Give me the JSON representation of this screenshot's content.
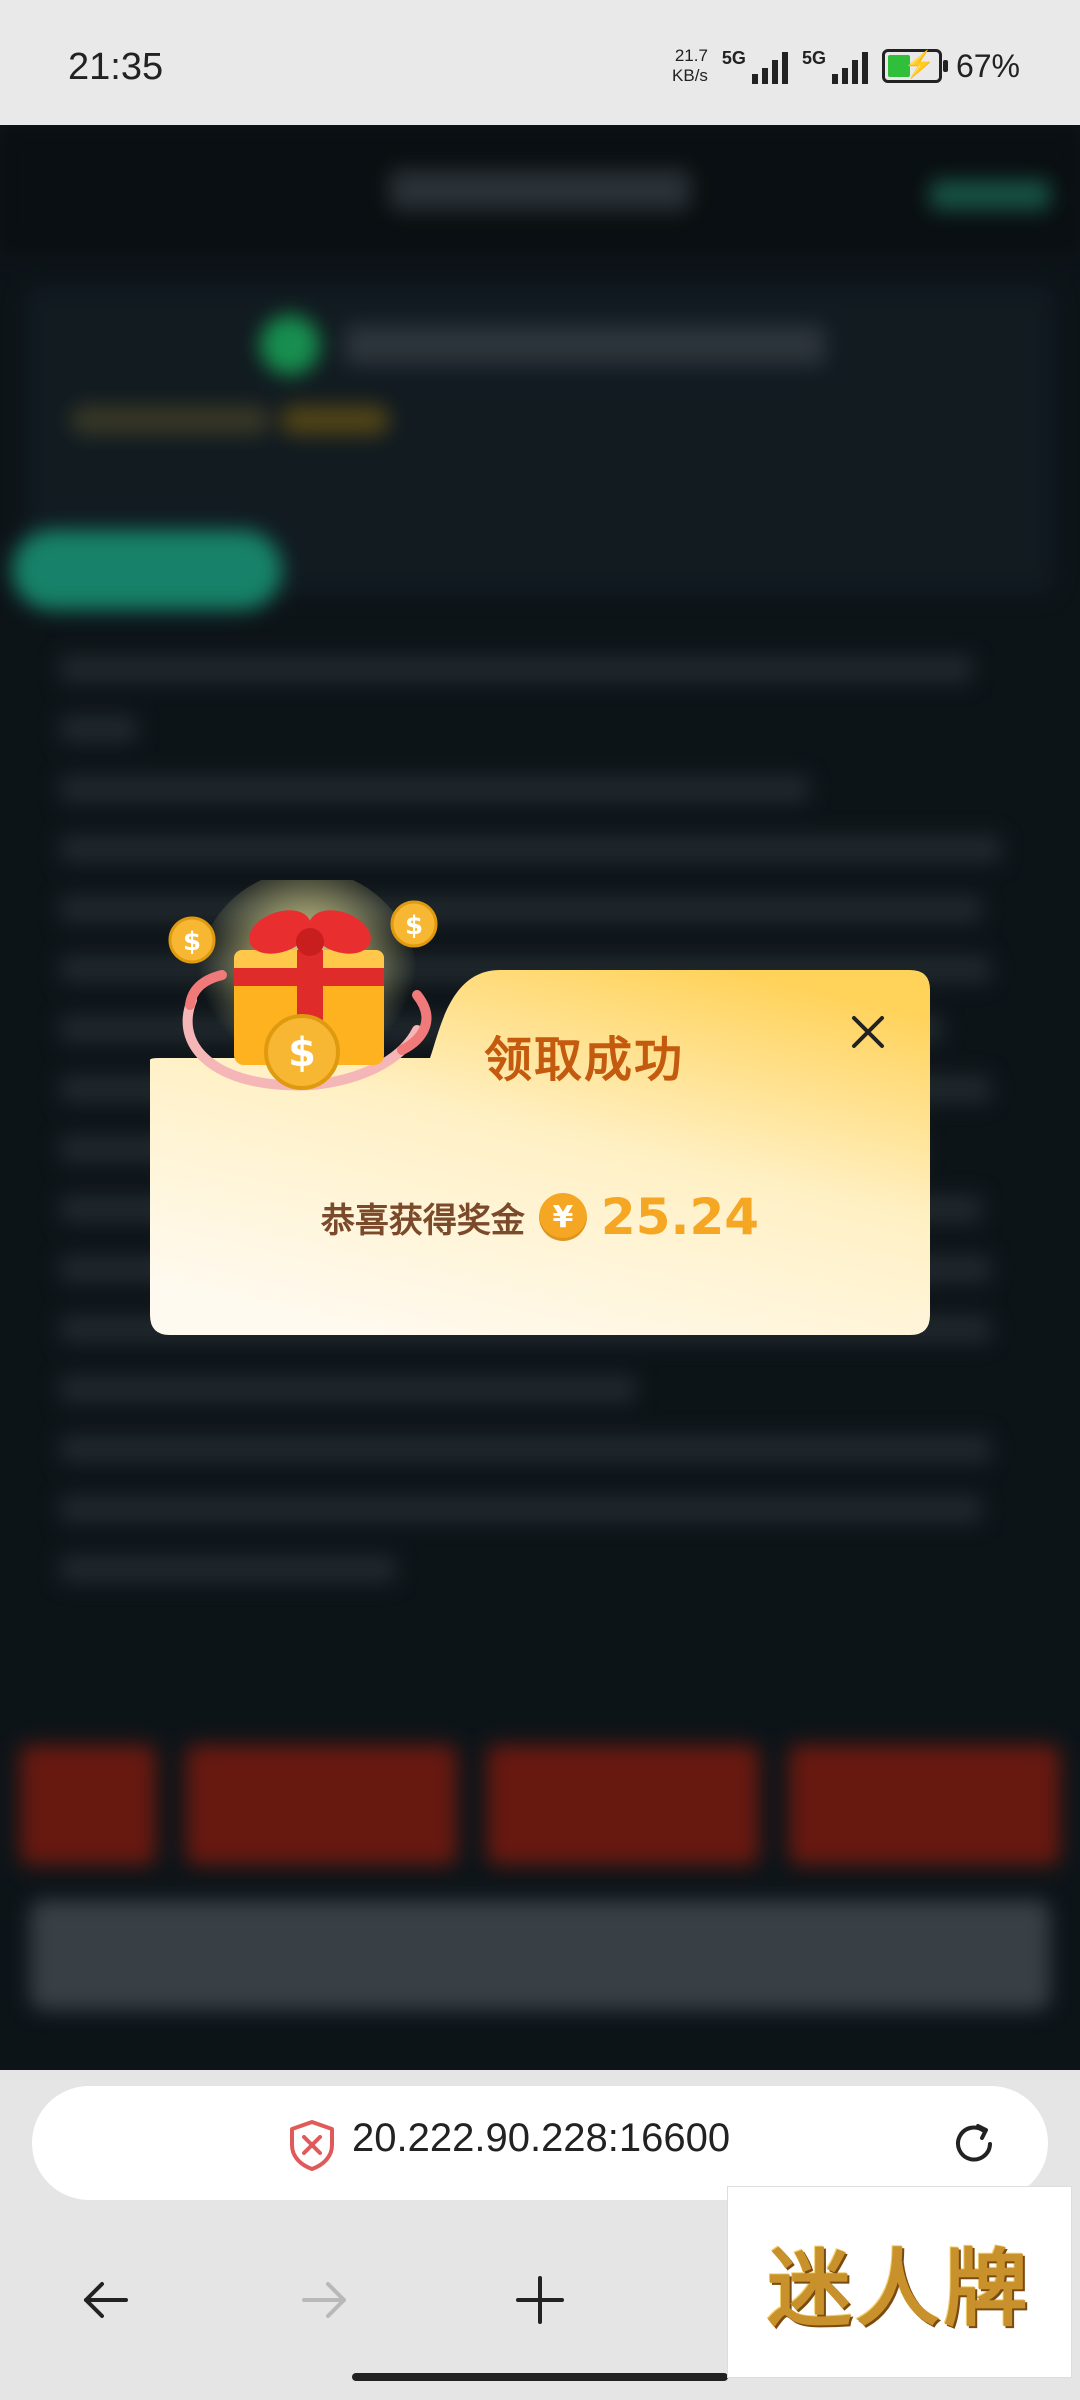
{
  "status_bar": {
    "time": "21:35",
    "net_speed_value": "21.7",
    "net_speed_unit": "KB/s",
    "signal1_label": "5G",
    "signal2_label": "5G",
    "battery_percent": "67%",
    "battery_level": 0.67
  },
  "popup": {
    "title": "领取成功",
    "reward_label": "恭喜获得奖金",
    "currency_symbol": "¥",
    "amount": "25.24"
  },
  "browser": {
    "url": "20.222.90.228:16600"
  },
  "watermark": {
    "text": "迷人牌"
  }
}
